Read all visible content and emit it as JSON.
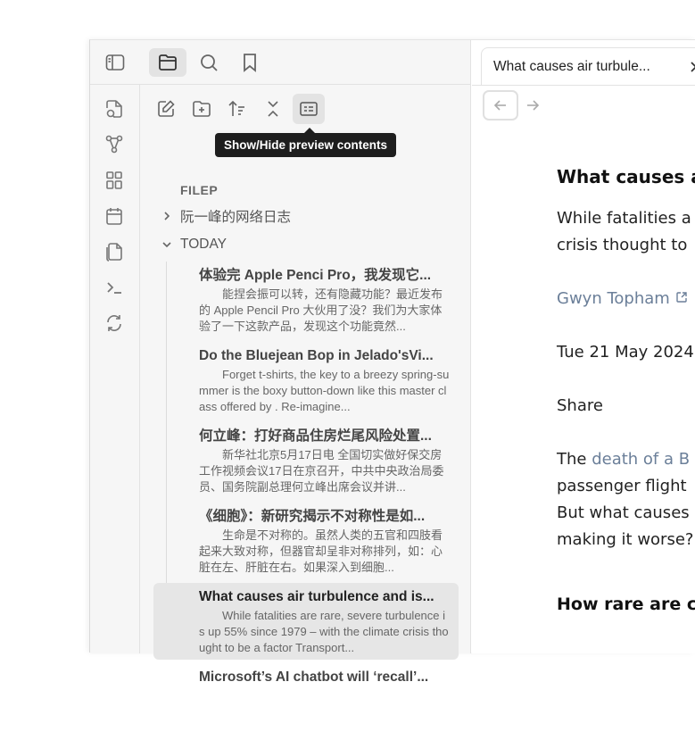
{
  "toolbar": {
    "icons": [
      "sidebar-toggle-icon",
      "folder-icon",
      "search-icon",
      "bookmark-icon"
    ]
  },
  "ribbon": {
    "icons": [
      "new-note-icon",
      "graph-icon",
      "canvas-icon",
      "calendar-icon",
      "copy-icon",
      "terminal-icon",
      "sync-icon"
    ]
  },
  "file_nav": {
    "buttons": [
      "new-note-icon",
      "new-folder-icon",
      "sort-icon",
      "collapse-all-icon",
      "preview-toggle-icon"
    ],
    "tooltip": "Show/Hide preview contents",
    "section_label": "FILEP",
    "folders": [
      {
        "label": "阮一峰的网络日志",
        "expanded": false
      },
      {
        "label": "TODAY",
        "expanded": true
      }
    ],
    "notes": [
      {
        "title": "体验完 Apple Penci Pro，我发现它...",
        "preview": "能捏会振可以转，还有隐藏功能？最近发布的 Apple Pencil Pro 大伙用了没？我们为大家体验了一下这款产品，发现这个功能竟然..."
      },
      {
        "title": "Do the Bluejean Bop in Jelado'sVi...",
        "preview": "Forget t-shirts, the key to a breezy spring-summer is the boxy button-down like this master class offered by . Re-imagine..."
      },
      {
        "title": "何立峰：打好商品住房烂尾风险处置...",
        "preview": "新华社北京5月17日电 全国切实做好保交房工作视频会议17日在京召开，中共中央政治局委员、国务院副总理何立峰出席会议并讲..."
      },
      {
        "title": "《细胞》：新研究揭示不对称性是如...",
        "preview": "生命是不对称的。虽然人类的五官和四肢看起来大致对称，但器官却呈非对称排列，如：心脏在左、肝脏在右。如果深入到细胞..."
      },
      {
        "title": "What causes air turbulence and is...",
        "preview": "While fatalities are rare, severe turbulence is up 55% since 1979 – with the climate crisis thought to be a factor  Transport...",
        "active": true
      },
      {
        "title": "Microsoft’s AI chatbot will ‘recall’...",
        "preview": ""
      }
    ]
  },
  "tab": {
    "title": "What causes air turbule...",
    "close": "×"
  },
  "article": {
    "heading": "What causes ai",
    "para1_line1": "While fatalities a",
    "para1_line2": "crisis thought to",
    "author": "Gwyn Topham",
    "date": "Tue 21 May 2024",
    "share": "Share",
    "para2_prefix": "The ",
    "para2_link": "death of a B",
    "para2_line2": "passenger flight",
    "para2_line3": "But what causes",
    "para2_line4": "making it worse?",
    "heading2": "How rare are ca"
  },
  "colors": {
    "link": "#6b7f99",
    "active_bg": "#e3e3e3",
    "tooltip_bg": "#1e1e1e"
  }
}
